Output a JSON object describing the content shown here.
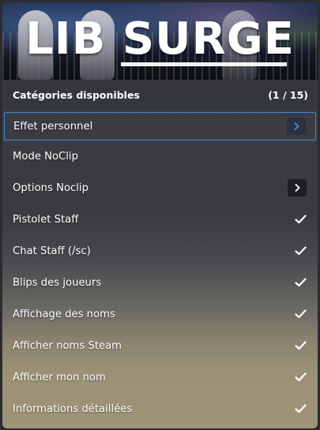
{
  "header": {
    "logo_text": "LIB SURGE",
    "subtitle_label": "Catégories disponibles",
    "page_counter": "(1 / 15)"
  },
  "colors": {
    "selection_border": "#3f86d6",
    "submenu_arrow_selected": "#4c8fe0",
    "submenu_arrow_default": "#ffffff",
    "checkmark": "#ffffff"
  },
  "items": [
    {
      "label": "Effet personnel",
      "right": "submenu-arrow",
      "selected": true
    },
    {
      "label": "Mode NoClip",
      "right": "none",
      "selected": false
    },
    {
      "label": "Options Noclip",
      "right": "submenu-arrow",
      "selected": false
    },
    {
      "label": "Pistolet Staff",
      "right": "checkmark",
      "selected": false
    },
    {
      "label": "Chat Staff (/sc)",
      "right": "checkmark",
      "selected": false
    },
    {
      "label": "Blips des joueurs",
      "right": "checkmark",
      "selected": false
    },
    {
      "label": "Affichage des noms",
      "right": "checkmark",
      "selected": false
    },
    {
      "label": "Afficher noms Steam",
      "right": "checkmark",
      "selected": false
    },
    {
      "label": "Afficher mon nom",
      "right": "checkmark",
      "selected": false
    },
    {
      "label": "Informations détaillées",
      "right": "checkmark",
      "selected": false
    }
  ]
}
